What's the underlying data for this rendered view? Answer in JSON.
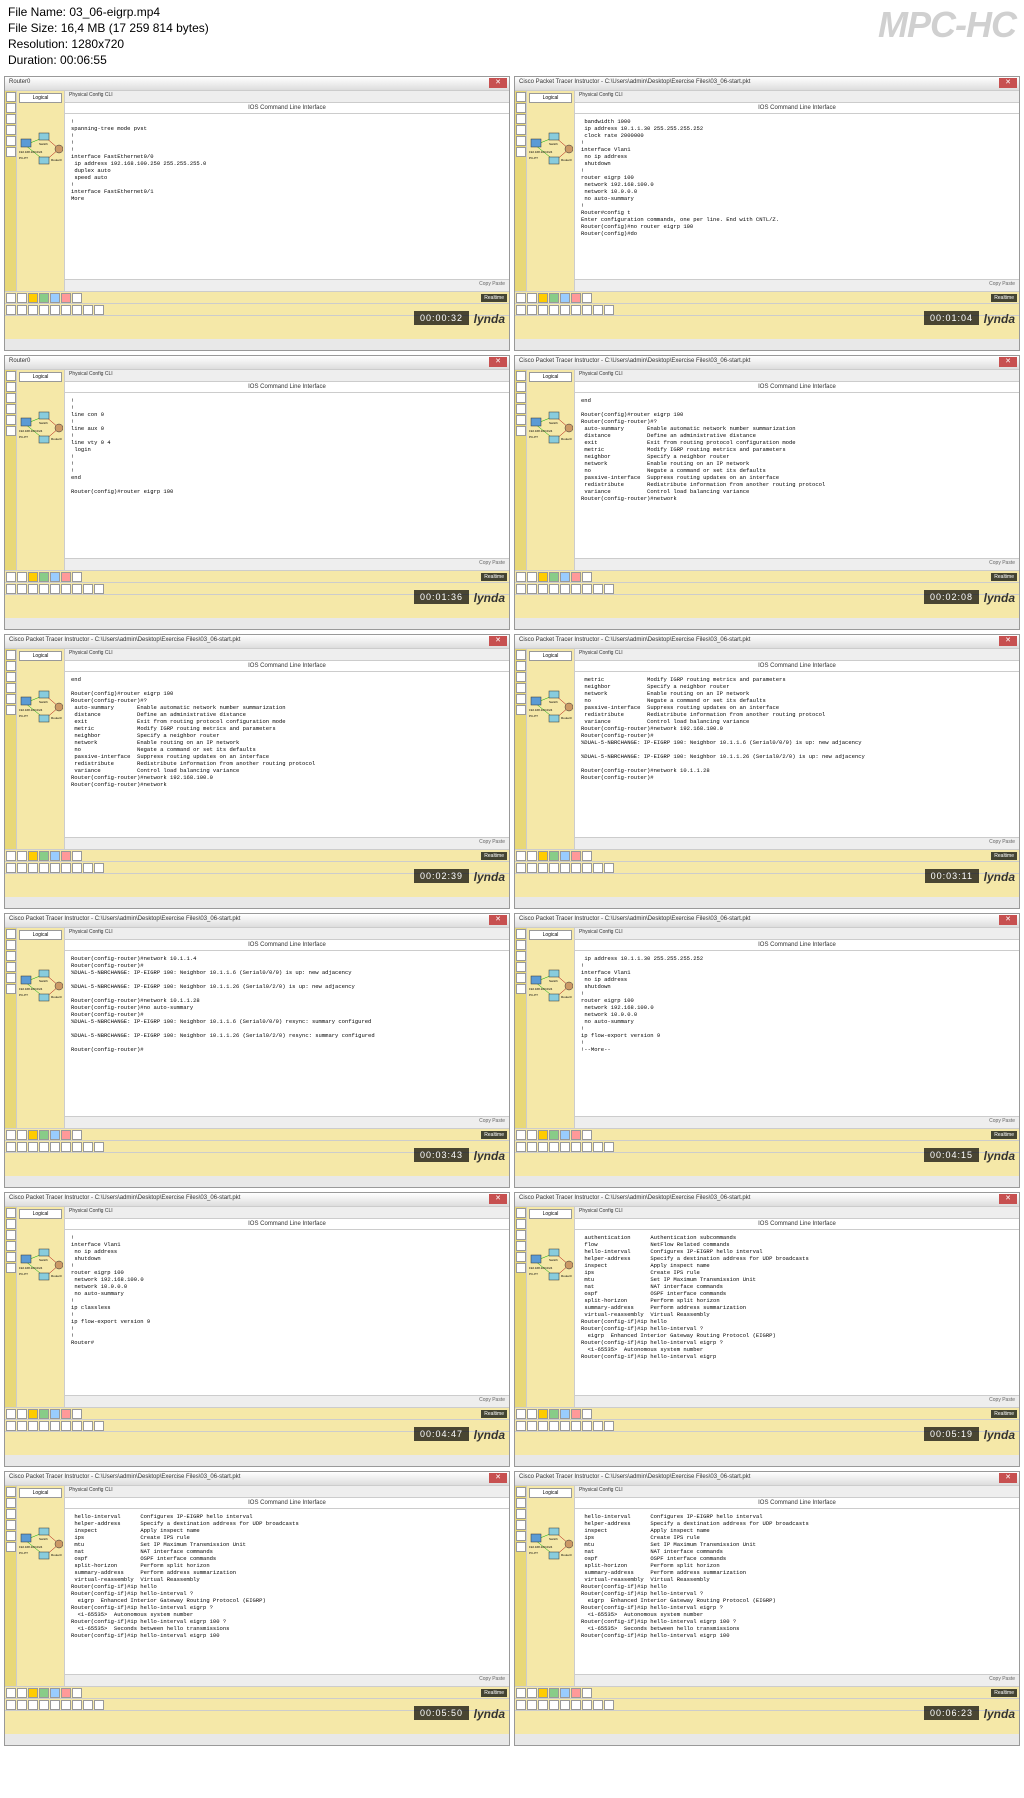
{
  "header": {
    "filename_label": "File Name:",
    "filename": "03_06-eigrp.mp4",
    "filesize_label": "File Size:",
    "filesize": "16,4 MB (17 259 814 bytes)",
    "resolution_label": "Resolution:",
    "resolution": "1280x720",
    "duration_label": "Duration:",
    "duration": "00:06:55",
    "logo": "MPC-HC"
  },
  "common": {
    "cli_title": "IOS Command Line Interface",
    "tabs": "Physical   Config   CLI",
    "logical": "Logical",
    "copy_paste": "Copy    Paste",
    "realtime": "Realtime",
    "lynda": "lynda",
    "router_title": "Router0",
    "pt_title": "Cisco Packet Tracer Instructor - C:\\Users\\admin\\Desktop\\Exercise Files\\03_06-start.pkt"
  },
  "thumbs": [
    {
      "ts": "00:00:32",
      "body": "!\nspanning-tree mode pvst\n!\n!\n!\ninterface FastEthernet0/0\n ip address 192.168.100.250 255.255.255.0\n duplex auto\n speed auto\n!\ninterface FastEthernet0/1\nMore"
    },
    {
      "ts": "00:01:04",
      "body": " bandwidth 1000\n ip address 10.1.1.30 255.255.255.252\n clock rate 2000000\n!\ninterface Vlan1\n no ip address\n shutdown\n!\nrouter eigrp 100\n network 192.168.100.0\n network 10.0.0.0\n no auto-summary\n!\nRouter#config t\nEnter configuration commands, one per line. End with CNTL/Z.\nRouter(config)#no router eigrp 100\nRouter(config)#do"
    },
    {
      "ts": "00:01:36",
      "body": "!\n!\nline con 0\n!\nline aux 0\n!\nline vty 0 4\n login\n!\n!\n!\nend\n\nRouter(config)#router eigrp 100"
    },
    {
      "ts": "00:02:08",
      "body": "end\n\nRouter(config)#router eigrp 100\nRouter(config-router)#?\n auto-summary       Enable automatic network number summarization\n distance           Define an administrative distance\n exit               Exit from routing protocol configuration mode\n metric             Modify IGRP routing metrics and parameters\n neighbor           Specify a neighbor router\n network            Enable routing on an IP network\n no                 Negate a command or set its defaults\n passive-interface  Suppress routing updates on an interface\n redistribute       Redistribute information from another routing protocol\n variance           Control load balancing variance\nRouter(config-router)#network"
    },
    {
      "ts": "00:02:39",
      "body": "end\n\nRouter(config)#router eigrp 100\nRouter(config-router)#?\n auto-summary       Enable automatic network number summarization\n distance           Define an administrative distance\n exit               Exit from routing protocol configuration mode\n metric             Modify IGRP routing metrics and parameters\n neighbor           Specify a neighbor router\n network            Enable routing on an IP network\n no                 Negate a command or set its defaults\n passive-interface  Suppress routing updates on an interface\n redistribute       Redistribute information from another routing protocol\n variance           Control load balancing variance\nRouter(config-router)#network 192.168.100.0\nRouter(config-router)#network"
    },
    {
      "ts": "00:03:11",
      "body": " metric             Modify IGRP routing metrics and parameters\n neighbor           Specify a neighbor router\n network            Enable routing on an IP network\n no                 Negate a command or set its defaults\n passive-interface  Suppress routing updates on an interface\n redistribute       Redistribute information from another routing protocol\n variance           Control load balancing variance\nRouter(config-router)#network 192.168.100.0\nRouter(config-router)#\n%DUAL-5-NBRCHANGE: IP-EIGRP 100: Neighbor 10.1.1.6 (Serial0/0/0) is up: new adjacency\n\n%DUAL-5-NBRCHANGE: IP-EIGRP 100: Neighbor 10.1.1.26 (Serial0/2/0) is up: new adjacency\n\nRouter(config-router)#network 10.1.1.28\nRouter(config-router)#"
    },
    {
      "ts": "00:03:43",
      "body": "Router(config-router)#network 10.1.1.4\nRouter(config-router)#\n%DUAL-5-NBRCHANGE: IP-EIGRP 100: Neighbor 10.1.1.6 (Serial0/0/0) is up: new adjacency\n\n%DUAL-5-NBRCHANGE: IP-EIGRP 100: Neighbor 10.1.1.26 (Serial0/2/0) is up: new adjacency\n\nRouter(config-router)#network 10.1.1.28\nRouter(config-router)#no auto-summary\nRouter(config-router)#\n%DUAL-5-NBRCHANGE: IP-EIGRP 100: Neighbor 10.1.1.6 (Serial0/0/0) resync: summary configured\n\n%DUAL-5-NBRCHANGE: IP-EIGRP 100: Neighbor 10.1.1.26 (Serial0/2/0) resync: summary configured\n\nRouter(config-router)#"
    },
    {
      "ts": "00:04:15",
      "body": " ip address 10.1.1.30 255.255.255.252\n!\ninterface Vlan1\n no ip address\n shutdown\n!\nrouter eigrp 100\n network 192.168.100.0\n network 10.0.0.0\n no auto-summary\n!\nip flow-export version 9\n!\n!--More--"
    },
    {
      "ts": "00:04:47",
      "body": "!\ninterface Vlan1\n no ip address\n shutdown\n!\nrouter eigrp 100\n network 192.168.100.0\n network 10.0.0.0\n no auto-summary\n!\nip classless\n!\nip flow-export version 9\n!\n!\nRouter#"
    },
    {
      "ts": "00:05:19",
      "body": " authentication      Authentication subcommands\n flow                NetFlow Related commands\n hello-interval      Configures IP-EIGRP hello interval\n helper-address      Specify a destination address for UDP broadcasts\n inspect             Apply inspect name\n ips                 Create IPS rule\n mtu                 Set IP Maximum Transmission Unit\n nat                 NAT interface commands\n ospf                OSPF interface commands\n split-horizon       Perform split horizon\n summary-address     Perform address summarization\n virtual-reassembly  Virtual Reassembly\nRouter(config-if)#ip hello\nRouter(config-if)#ip hello-interval ?\n  eigrp  Enhanced Interior Gateway Routing Protocol (EIGRP)\nRouter(config-if)#ip hello-interval eigrp ?\n  <1-65535>  Autonomous system number\nRouter(config-if)#ip hello-interval eigrp"
    },
    {
      "ts": "00:05:50",
      "body": " hello-interval      Configures IP-EIGRP hello interval\n helper-address      Specify a destination address for UDP broadcasts\n inspect             Apply inspect name\n ips                 Create IPS rule\n mtu                 Set IP Maximum Transmission Unit\n nat                 NAT interface commands\n ospf                OSPF interface commands\n split-horizon       Perform split horizon\n summary-address     Perform address summarization\n virtual-reassembly  Virtual Reassembly\nRouter(config-if)#ip hello\nRouter(config-if)#ip hello-interval ?\n  eigrp  Enhanced Interior Gateway Routing Protocol (EIGRP)\nRouter(config-if)#ip hello-interval eigrp ?\n  <1-65535>  Autonomous system number\nRouter(config-if)#ip hello-interval eigrp 100 ?\n  <1-65535>  Seconds between hello transmissions\nRouter(config-if)#ip hello-interval eigrp 100"
    },
    {
      "ts": "00:06:23",
      "body": " hello-interval      Configures IP-EIGRP hello interval\n helper-address      Specify a destination address for UDP broadcasts\n inspect             Apply inspect name\n ips                 Create IPS rule\n mtu                 Set IP Maximum Transmission Unit\n nat                 NAT interface commands\n ospf                OSPF interface commands\n split-horizon       Perform split horizon\n summary-address     Perform address summarization\n virtual-reassembly  Virtual Reassembly\nRouter(config-if)#ip hello\nRouter(config-if)#ip hello-interval ?\n  eigrp  Enhanced Interior Gateway Routing Protocol (EIGRP)\nRouter(config-if)#ip hello-interval eigrp ?\n  <1-65535>  Autonomous system number\nRouter(config-if)#ip hello-interval eigrp 100 ?\n  <1-65535>  Seconds between hello transmissions\nRouter(config-if)#ip hello-interval eigrp 100"
    }
  ]
}
